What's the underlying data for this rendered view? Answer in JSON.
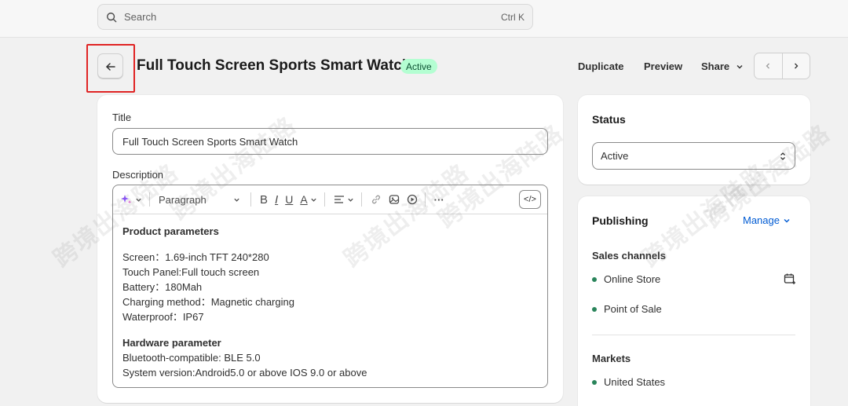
{
  "search": {
    "placeholder": "Search",
    "shortcut": "Ctrl K"
  },
  "header": {
    "title": "Full Touch Screen Sports Smart Watch",
    "status_badge": "Active",
    "actions": {
      "duplicate": "Duplicate",
      "preview": "Preview",
      "share": "Share"
    }
  },
  "product": {
    "title_label": "Title",
    "title_value": "Full Touch Screen Sports Smart Watch",
    "description_label": "Description",
    "editor": {
      "paragraph_label": "Paragraph",
      "bold": "B",
      "italic": "I",
      "underline": "U",
      "text_color": "A",
      "more": "···",
      "code": "</>"
    },
    "description": {
      "heading1": "Product parameters",
      "lines1": [
        "Screen：1.69-inch TFT 240*280",
        "Touch Panel:Full touch screen",
        "Battery：180Mah",
        "Charging method：Magnetic charging",
        "Waterproof：IP67"
      ],
      "heading2": "Hardware parameter",
      "lines2": [
        "Bluetooth-compatible: BLE 5.0",
        "System version:Android5.0 or above IOS 9.0 or above"
      ]
    }
  },
  "status_card": {
    "title": "Status",
    "value": "Active"
  },
  "publishing": {
    "title": "Publishing",
    "manage": "Manage",
    "sales_channels_label": "Sales channels",
    "channels": [
      "Online Store",
      "Point of Sale"
    ],
    "markets_label": "Markets",
    "markets": [
      "United States"
    ]
  },
  "watermark": "跨境出海陆路",
  "colors": {
    "accent": "#005bd3",
    "badge_bg": "#b4fed2",
    "badge_text": "#0c5132",
    "dot": "#29845a",
    "highlight": "#e02424"
  }
}
